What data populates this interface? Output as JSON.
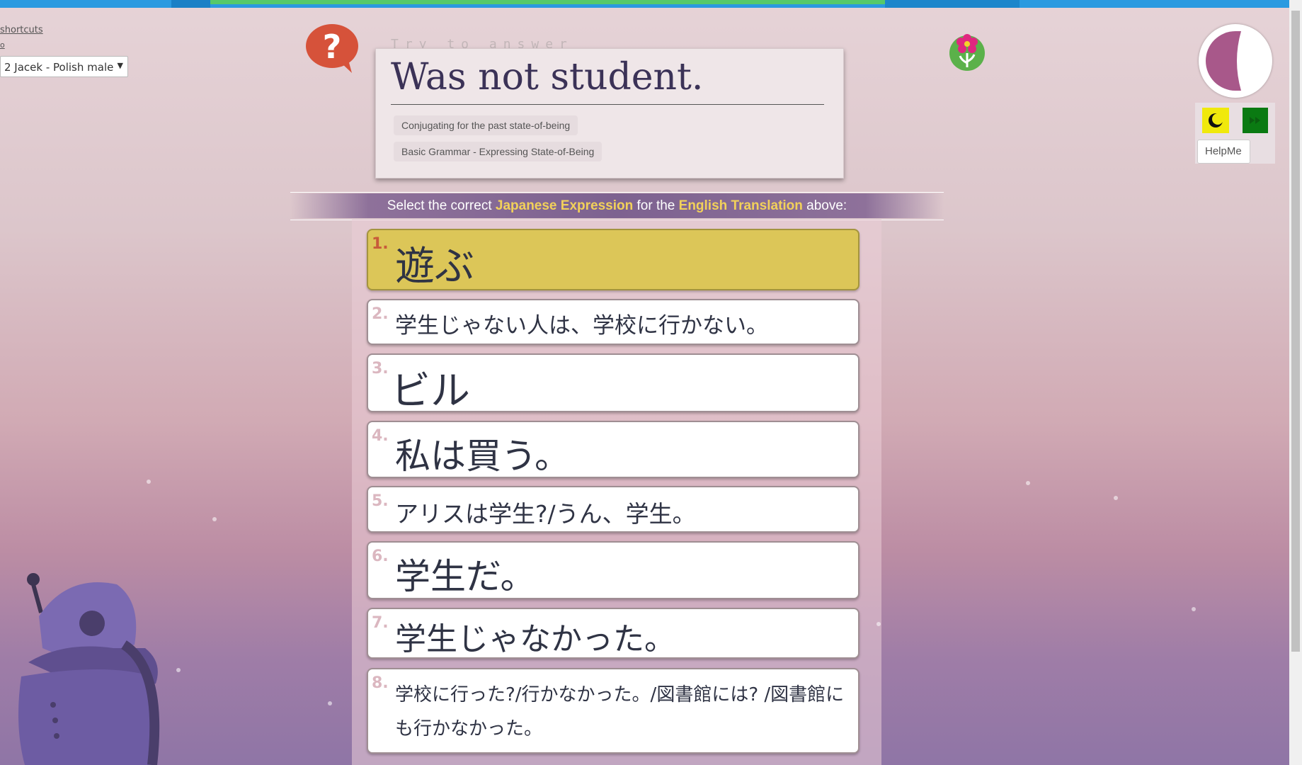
{
  "top_left": {
    "shortcuts_label": "shortcuts",
    "link2_label": "o",
    "voice_select": "2 Jacek - Polish male"
  },
  "question": {
    "prompt_label": "Try to answer",
    "english": "Was not student.",
    "tags": [
      "Conjugating for the past state-of-being",
      "Basic Grammar - Expressing State-of-Being"
    ]
  },
  "instruction": {
    "part1": "Select the correct ",
    "highlight1": "Japanese Expression",
    "part2": " for the ",
    "highlight2": "English Translation",
    "part3": " above:"
  },
  "answers": [
    {
      "num": "1.",
      "text": "遊ぶ"
    },
    {
      "num": "2.",
      "text": "学生じゃない人は、学校に行かない。"
    },
    {
      "num": "3.",
      "text": "ビル"
    },
    {
      "num": "4.",
      "text": "私は買う。"
    },
    {
      "num": "5.",
      "text": "アリスは学生?/うん、学生。"
    },
    {
      "num": "6.",
      "text": "学生だ。"
    },
    {
      "num": "7.",
      "text": "学生じゃなかった。"
    },
    {
      "num": "8.",
      "text": "学校に行った?/行かなかった。/図書館には? /図書館にも行かなかった。"
    }
  ],
  "tools": {
    "helpme_label": "HelpMe",
    "night_mode_icon": "moon-icon",
    "skip_icon": "fast-forward-icon"
  },
  "colors": {
    "selected_answer": "#dcc658",
    "highlight_text": "#f2d15a",
    "progress": "#55c96a",
    "top_bar": "#2a9ae0"
  }
}
